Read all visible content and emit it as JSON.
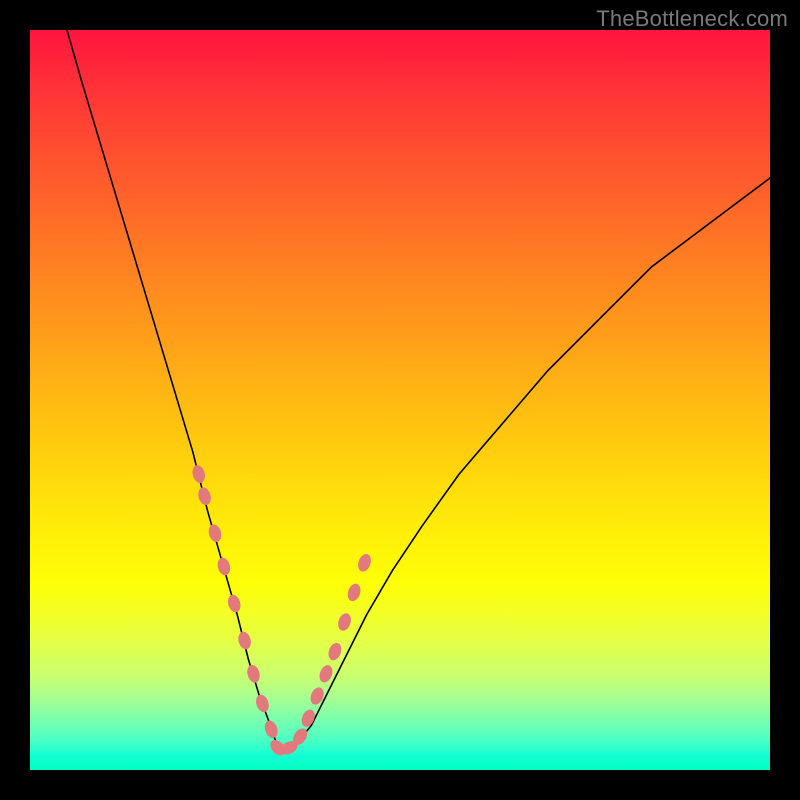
{
  "watermark": "TheBottleneck.com",
  "colors": {
    "frame_bg": "#000000",
    "curve": "#000000",
    "marker": "#e27a7d",
    "gradient_top": "#ff153f",
    "gradient_bottom": "#00ffbf"
  },
  "chart_data": {
    "type": "line",
    "title": "",
    "xlabel": "",
    "ylabel": "",
    "xlim": [
      0,
      100
    ],
    "ylim": [
      0,
      100
    ],
    "notes": "V-shaped bottleneck curve on a vertical red→yellow→green gradient. Minimum of the curve touches the green band near the bottom. Axis values are estimated from the plot area proportions (no tick labels present).",
    "series": [
      {
        "name": "bottleneck-curve",
        "x": [
          5,
          7,
          10,
          13,
          16,
          19,
          22,
          24,
          26,
          28,
          29.5,
          31,
          32.5,
          33.5,
          35.5,
          38,
          40,
          42.5,
          45.5,
          49,
          53,
          58,
          64,
          70,
          77,
          84,
          92,
          100
        ],
        "y": [
          100,
          93,
          83,
          73,
          63,
          53,
          43,
          35,
          28,
          21,
          15,
          10,
          6,
          3,
          3,
          6,
          10,
          15,
          21,
          27,
          33,
          40,
          47,
          54,
          61,
          68,
          74,
          80
        ]
      },
      {
        "name": "marker-dots",
        "x": [
          22.8,
          23.6,
          25.0,
          26.2,
          27.6,
          29.0,
          30.2,
          31.4,
          32.6,
          33.5,
          35.0,
          36.5,
          37.6,
          38.8,
          40.0,
          41.2,
          42.5,
          43.8,
          45.2
        ],
        "y": [
          40,
          37,
          32,
          27.5,
          22.5,
          17.5,
          13,
          9,
          5.5,
          3,
          3,
          4.5,
          7,
          10,
          13,
          16,
          20,
          24,
          28
        ]
      }
    ]
  }
}
